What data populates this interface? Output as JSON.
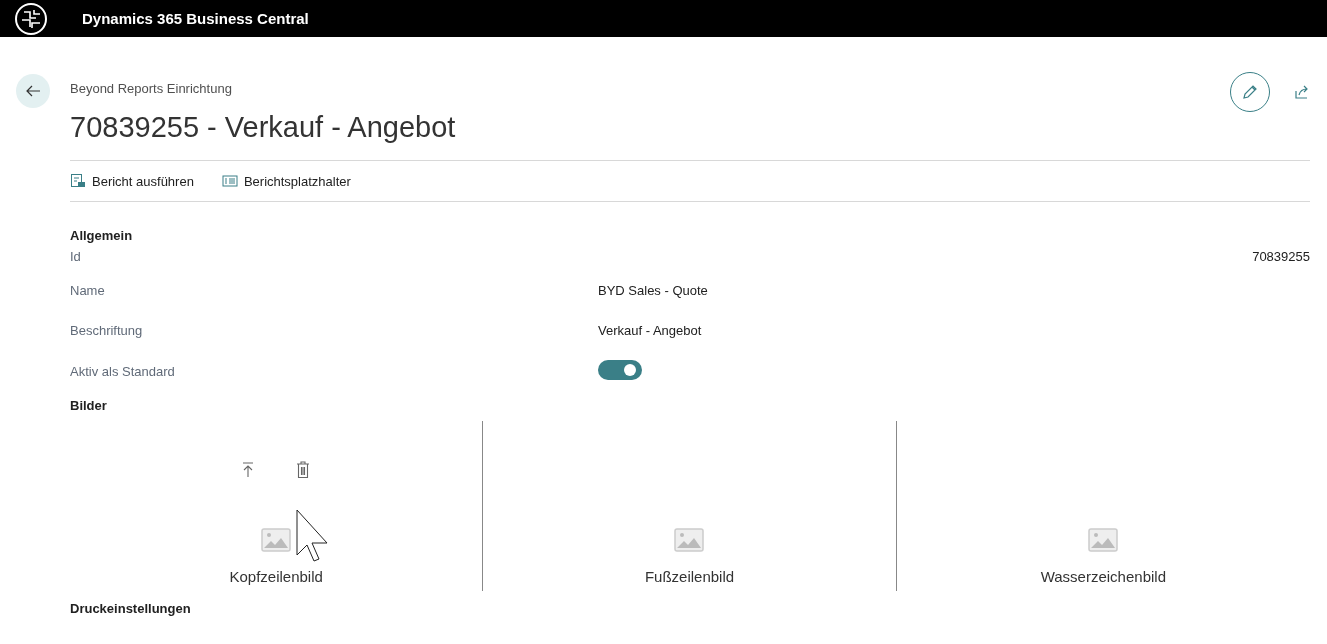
{
  "app_bar": {
    "title": "Dynamics 365 Business Central"
  },
  "breadcrumb": "Beyond Reports Einrichtung",
  "title": "70839255 - Verkauf - Angebot",
  "actions": [
    {
      "kind": "run",
      "label": "Bericht ausführen"
    },
    {
      "kind": "placeholder",
      "label": "Berichtsplatzhalter"
    }
  ],
  "general": {
    "heading": "Allgemein",
    "fields": [
      {
        "kind": "number",
        "label": "Id",
        "value": "70839255"
      },
      {
        "kind": "text",
        "label": "Name",
        "value": "BYD Sales - Quote"
      },
      {
        "kind": "text",
        "label": "Beschriftung",
        "value": "Verkauf - Angebot"
      },
      {
        "kind": "toggle",
        "label": "Aktiv als Standard",
        "on": true
      }
    ]
  },
  "images": {
    "heading": "Bilder",
    "items": [
      {
        "label": "Kopfzeilenbild",
        "hovered": true
      },
      {
        "label": "Fußzeilenbild",
        "hovered": false
      },
      {
        "label": "Wasserzeichenbild",
        "hovered": false
      }
    ]
  },
  "next_section": {
    "heading": "Druckeinstellungen"
  }
}
